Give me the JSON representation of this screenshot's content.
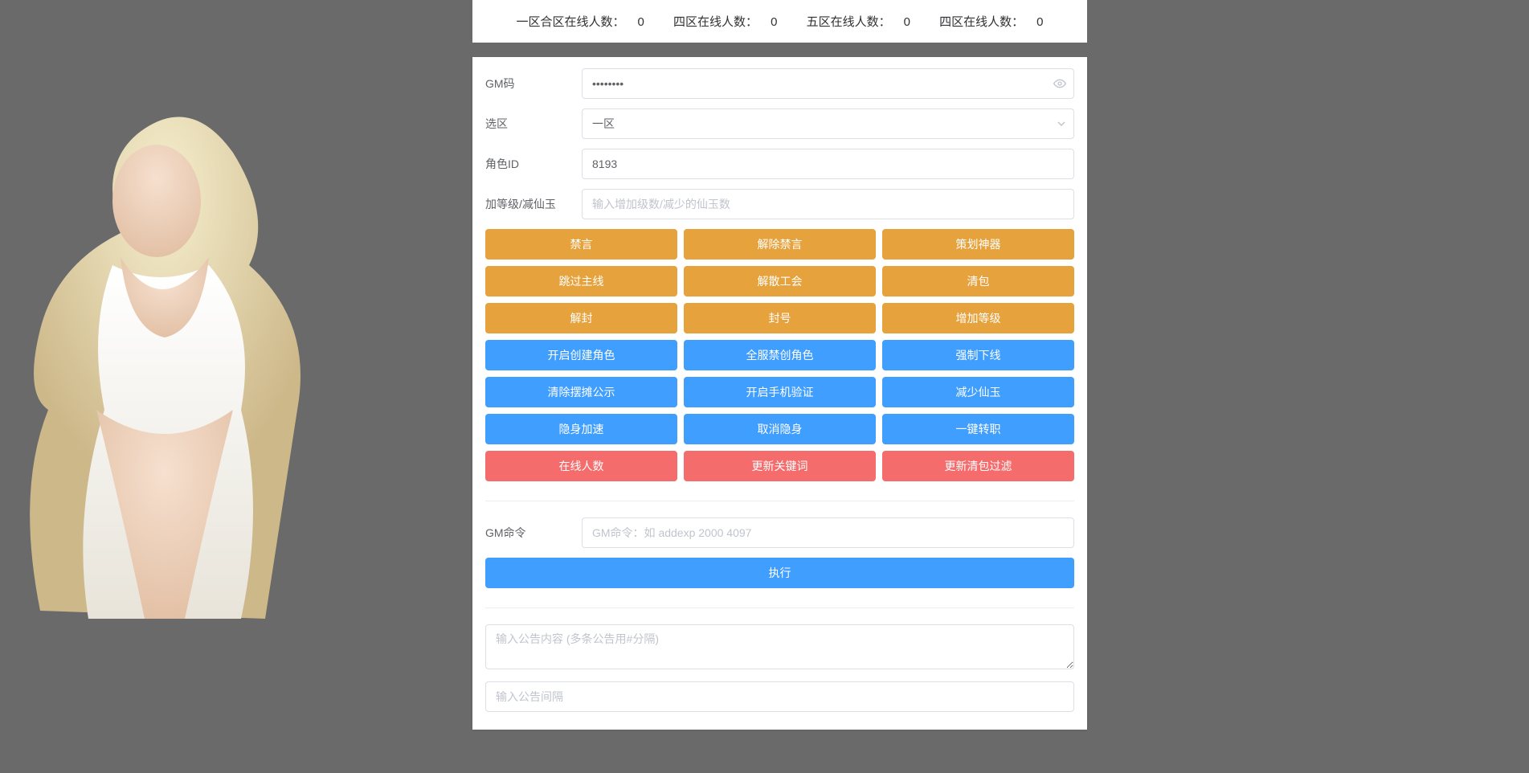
{
  "status": {
    "zone1_label": "一区合区在线人数：",
    "zone1_count": "0",
    "zone4_label": "四区在线人数：",
    "zone4_count": "0",
    "zone5_label": "五区在线人数：",
    "zone5_count": "0",
    "zone4b_label": "四区在线人数：",
    "zone4b_count": "0"
  },
  "form": {
    "gm_code_label": "GM码",
    "gm_code_value": "••••••••",
    "zone_label": "选区",
    "zone_value": "一区",
    "role_id_label": "角色ID",
    "role_id_value": "8193",
    "level_label": "加等级/减仙玉",
    "level_placeholder": "输入增加级数/减少的仙玉数"
  },
  "buttons_orange": [
    [
      "禁言",
      "解除禁言",
      "策划神器"
    ],
    [
      "跳过主线",
      "解散工会",
      "清包"
    ],
    [
      "解封",
      "封号",
      "增加等级"
    ]
  ],
  "buttons_blue": [
    [
      "开启创建角色",
      "全服禁创角色",
      "强制下线"
    ],
    [
      "清除摆摊公示",
      "开启手机验证",
      "减少仙玉"
    ],
    [
      "隐身加速",
      "取消隐身",
      "一键转职"
    ]
  ],
  "buttons_red": [
    [
      "在线人数",
      "更新关键词",
      "更新清包过滤"
    ]
  ],
  "cmd": {
    "label": "GM命令",
    "placeholder": "GM命令：如 addexp 2000 4097",
    "run_label": "执行"
  },
  "announce": {
    "content_placeholder": "输入公告内容 (多条公告用#分隔)",
    "interval_placeholder": "输入公告间隔"
  }
}
